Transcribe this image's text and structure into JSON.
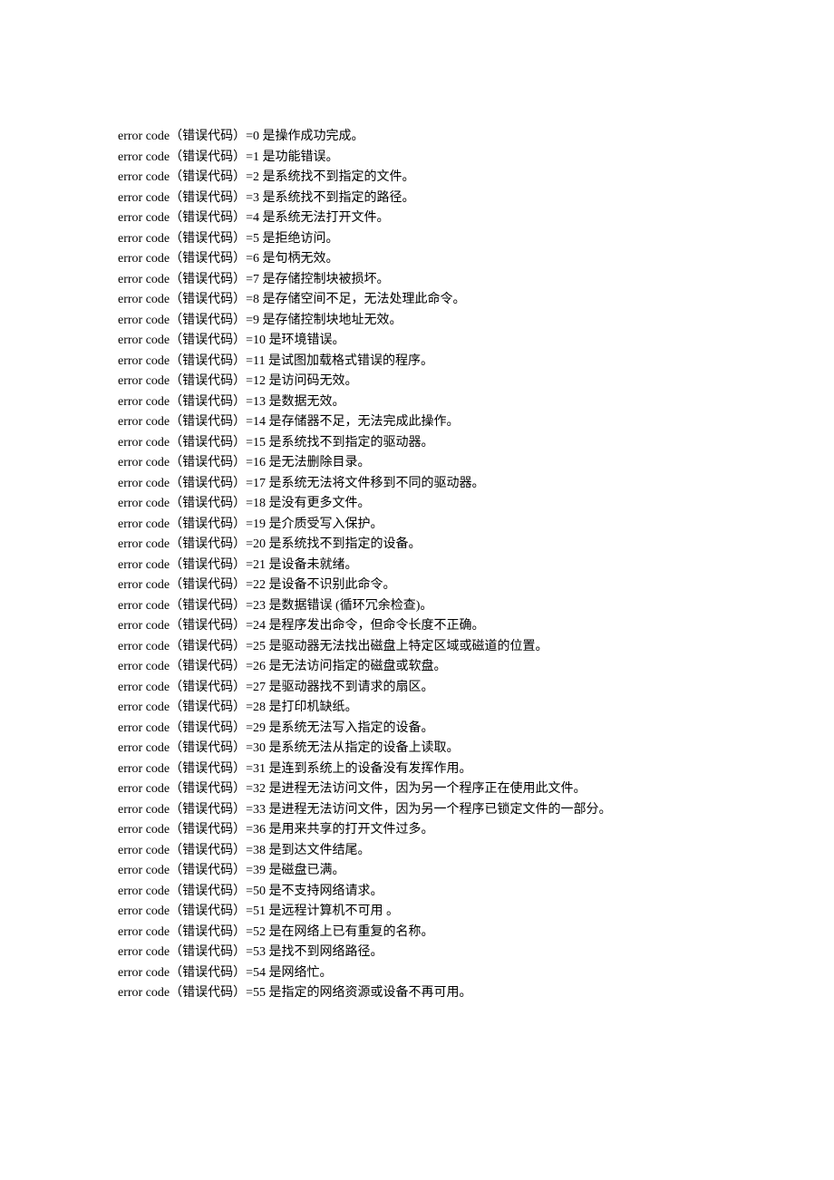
{
  "error_codes": [
    {
      "prefix": "error code（错误代码）=0",
      "desc": " 是操作成功完成。"
    },
    {
      "prefix": "error code（错误代码）=1",
      "desc": " 是功能错误。"
    },
    {
      "prefix": "error code（错误代码）=2",
      "desc": " 是系统找不到指定的文件。"
    },
    {
      "prefix": "error code（错误代码）=3",
      "desc": " 是系统找不到指定的路径。"
    },
    {
      "prefix": "error code（错误代码）=4",
      "desc": " 是系统无法打开文件。"
    },
    {
      "prefix": "error code（错误代码）=5",
      "desc": " 是拒绝访问。"
    },
    {
      "prefix": "error code（错误代码）=6",
      "desc": " 是句柄无效。"
    },
    {
      "prefix": "error code（错误代码）=7",
      "desc": " 是存储控制块被损坏。"
    },
    {
      "prefix": "error code（错误代码）=8",
      "desc": " 是存储空间不足，无法处理此命令。"
    },
    {
      "prefix": "error code（错误代码）=9",
      "desc": " 是存储控制块地址无效。"
    },
    {
      "prefix": "error code（错误代码）=10",
      "desc": " 是环境错误。"
    },
    {
      "prefix": "error code（错误代码）=11",
      "desc": " 是试图加载格式错误的程序。"
    },
    {
      "prefix": "error code（错误代码）=12",
      "desc": " 是访问码无效。"
    },
    {
      "prefix": "error code（错误代码）=13",
      "desc": " 是数据无效。"
    },
    {
      "prefix": "error code（错误代码）=14",
      "desc": " 是存储器不足，无法完成此操作。"
    },
    {
      "prefix": "error code（错误代码）=15",
      "desc": " 是系统找不到指定的驱动器。"
    },
    {
      "prefix": "error code（错误代码）=16",
      "desc": " 是无法删除目录。"
    },
    {
      "prefix": "error code（错误代码）=17",
      "desc": " 是系统无法将文件移到不同的驱动器。"
    },
    {
      "prefix": "error code（错误代码）=18",
      "desc": " 是没有更多文件。"
    },
    {
      "prefix": "error code（错误代码）=19",
      "desc": " 是介质受写入保护。"
    },
    {
      "prefix": "error code（错误代码）=20",
      "desc": " 是系统找不到指定的设备。"
    },
    {
      "prefix": "error code（错误代码）=21",
      "desc": " 是设备未就绪。"
    },
    {
      "prefix": "error code（错误代码）=22",
      "desc": " 是设备不识别此命令。"
    },
    {
      "prefix": "error code（错误代码）=23",
      "desc": " 是数据错误 (循环冗余检查)。"
    },
    {
      "prefix": "error code（错误代码）=24",
      "desc": " 是程序发出命令，但命令长度不正确。"
    },
    {
      "prefix": "error code（错误代码）=25",
      "desc": " 是驱动器无法找出磁盘上特定区域或磁道的位置。"
    },
    {
      "prefix": "error code（错误代码）=26",
      "desc": " 是无法访问指定的磁盘或软盘。"
    },
    {
      "prefix": "error code（错误代码）=27",
      "desc": " 是驱动器找不到请求的扇区。"
    },
    {
      "prefix": "error code（错误代码）=28",
      "desc": " 是打印机缺纸。"
    },
    {
      "prefix": "error code（错误代码）=29",
      "desc": " 是系统无法写入指定的设备。"
    },
    {
      "prefix": "error code（错误代码）=30",
      "desc": " 是系统无法从指定的设备上读取。"
    },
    {
      "prefix": "error code（错误代码）=31",
      "desc": " 是连到系统上的设备没有发挥作用。"
    },
    {
      "prefix": "error code（错误代码）=32",
      "desc": " 是进程无法访问文件，因为另一个程序正在使用此文件。"
    },
    {
      "prefix": "error code（错误代码）=33",
      "desc": " 是进程无法访问文件，因为另一个程序已锁定文件的一部分。"
    },
    {
      "prefix": "error code（错误代码）=36",
      "desc": " 是用来共享的打开文件过多。"
    },
    {
      "prefix": "error code（错误代码）=38",
      "desc": " 是到达文件结尾。"
    },
    {
      "prefix": "error code（错误代码）=39",
      "desc": " 是磁盘已满。"
    },
    {
      "prefix": "error code（错误代码）=50",
      "desc": " 是不支持网络请求。"
    },
    {
      "prefix": "error code（错误代码）=51",
      "desc": " 是远程计算机不可用 。"
    },
    {
      "prefix": "error code（错误代码）=52",
      "desc": " 是在网络上已有重复的名称。"
    },
    {
      "prefix": "error code（错误代码）=53",
      "desc": " 是找不到网络路径。"
    },
    {
      "prefix": "error code（错误代码）=54",
      "desc": " 是网络忙。"
    },
    {
      "prefix": "error code（错误代码）=55",
      "desc": " 是指定的网络资源或设备不再可用。"
    }
  ]
}
